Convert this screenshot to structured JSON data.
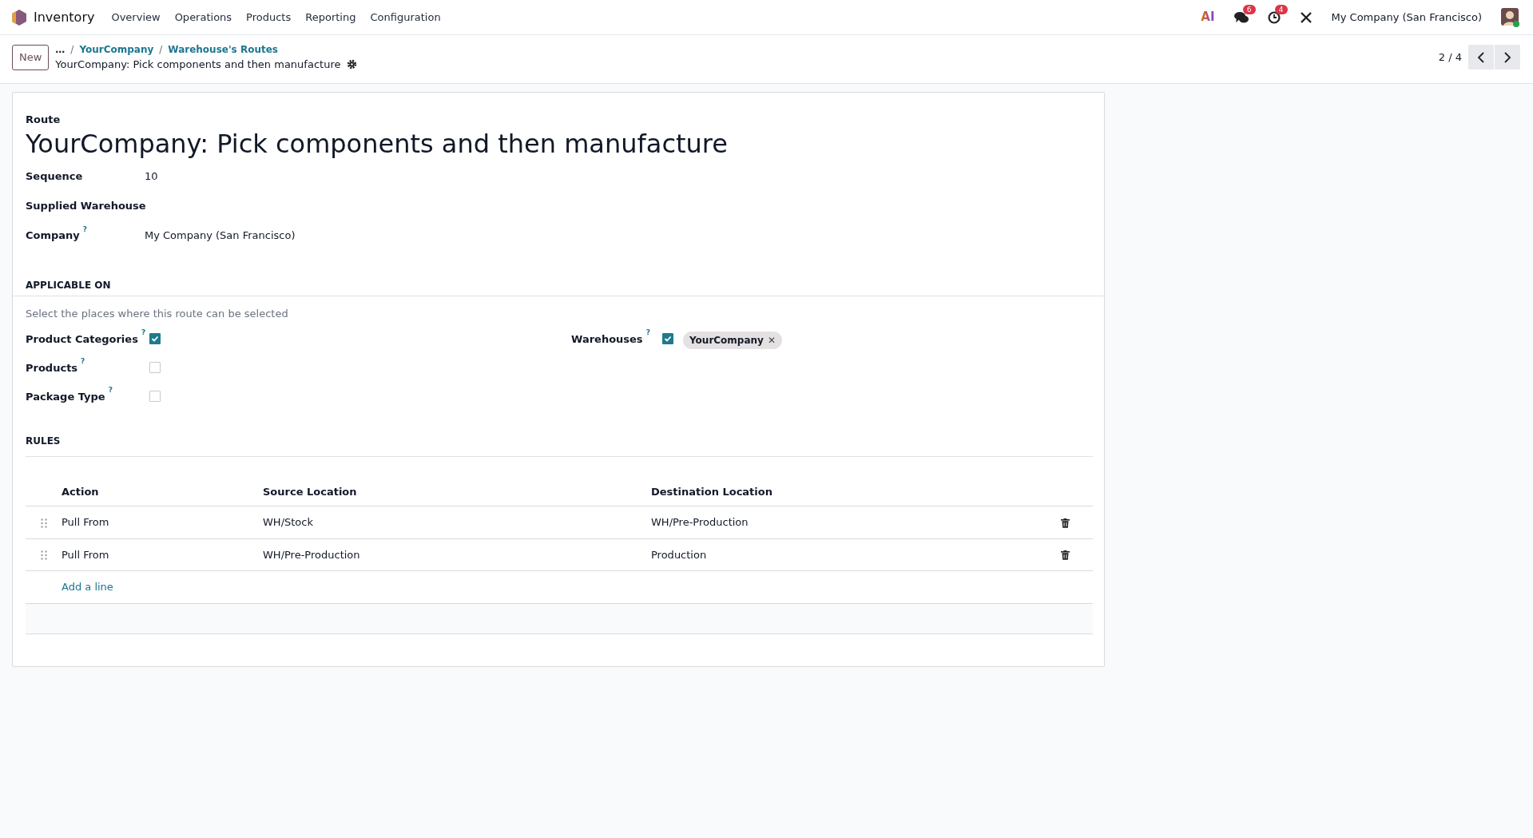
{
  "navbar": {
    "app_name": "Inventory",
    "menu": [
      {
        "label": "Overview"
      },
      {
        "label": "Operations"
      },
      {
        "label": "Products"
      },
      {
        "label": "Reporting"
      },
      {
        "label": "Configuration"
      }
    ],
    "systray": {
      "ai_label": "AI",
      "messages_count": "6",
      "activities_count": "4",
      "company": "My Company (San Francisco)"
    }
  },
  "control_panel": {
    "new_button": "New",
    "breadcrumb_separator": "/",
    "breadcrumbs": [
      {
        "label": "…"
      },
      {
        "label": "YourCompany"
      },
      {
        "label": "Warehouse's Routes"
      }
    ],
    "record_title": "YourCompany: Pick components and then manufacture",
    "pager": "2 / 4"
  },
  "form": {
    "record_label": "Route",
    "name": "YourCompany: Pick components and then manufacture",
    "fields": [
      {
        "label": "Sequence",
        "value": "10"
      },
      {
        "label": "Supplied Warehouse"
      },
      {
        "label": "Company",
        "help": "?",
        "value": "My Company (San Francisco)"
      }
    ],
    "applicable_on": {
      "heading": "APPLICABLE ON",
      "hint": "Select the places where this route can be selected",
      "left": [
        {
          "label": "Product Categories",
          "help": "?",
          "checked": true
        },
        {
          "label": "Products",
          "help": "?",
          "checked": false
        },
        {
          "label": "Package Type",
          "help": "?",
          "checked": false
        }
      ],
      "right": [
        {
          "label": "Warehouses",
          "help": "?",
          "checked": true,
          "tags": [
            "YourCompany"
          ],
          "tag_remove": "✕"
        }
      ]
    },
    "rules": {
      "heading": "RULES",
      "columns": [
        "Action",
        "Source Location",
        "Destination Location"
      ],
      "rows": [
        {
          "cells": [
            "Pull From",
            "WH/Stock",
            "WH/Pre-Production"
          ]
        },
        {
          "cells": [
            "Pull From",
            "WH/Pre-Production",
            "Production"
          ]
        }
      ],
      "add_line": "Add a line"
    }
  }
}
